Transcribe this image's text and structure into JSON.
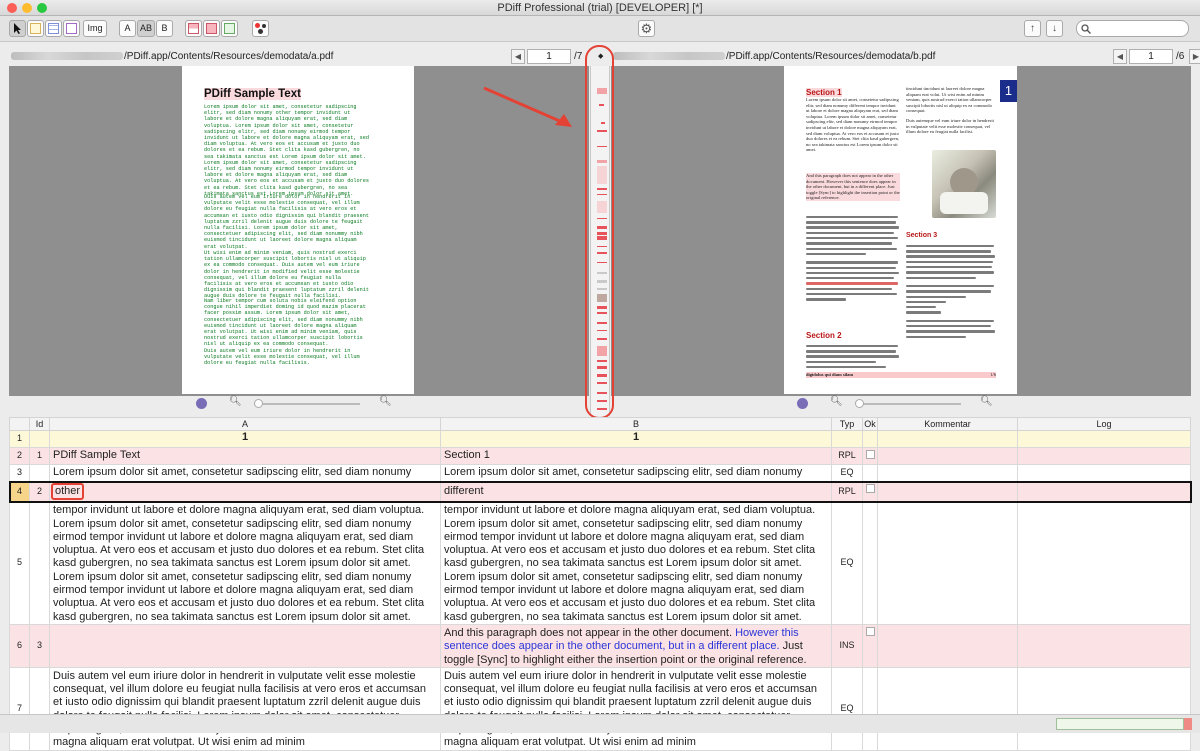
{
  "window": {
    "title": "PDiff Professional (trial) [DEVELOPER] [*]"
  },
  "toolbar": {
    "img_label": "Img",
    "a_label": "A",
    "ab_label": "AB",
    "b_label": "B"
  },
  "left": {
    "path": "/PDiff.app/Contents/Resources/demodata/a.pdf",
    "page": "1",
    "total": "/7"
  },
  "right": {
    "path": "/PDiff.app/Contents/Resources/demodata/b.pdf",
    "page": "1",
    "total": "/6"
  },
  "docA": {
    "title": "PDiff Sample Text",
    "p1": "Lorem ipsum dolor sit amet, consetetur sadipscing\nelitr, sed diam nonumy other tempor invidunt ut\nlabore et dolore magna aliquyam erat, sed diam\nvoluptua. Lorem ipsum dolor sit amet, consetetur\nsadipscing elitr, sed diam nonumy eirmod tempor\ninvidunt ut labore et dolore magna aliquyam erat, sed\ndiam voluptua. At vero eos et accusam et justo duo\ndolores et ea rebum. Stet clita kasd gubergren, no\nsea takimata sanctus est Lorem ipsum dolor sit amet.\nLorem ipsum dolor sit amet, consetetur sadipscing\nelitr, sed diam nonumy eirmod tempor invidunt ut\nlabore et dolore magna aliquyam erat, sed diam\nvoluptua. At vero eos et accusam et justo duo dolores\net ea rebum. Stet clita kasd gubergren, no sea\ntakimata sanctus est Lorem ipsum dolor sit amet.",
    "p2": "Duis autem vel eum iriure dolor in hendrerit in\nvulputate velit esse molestie consequat, vel illum\ndolore eu feugiat nulla facilisis at vero eros et\naccumsan et iusto odio dignissim qui blandit praesent\nluptatum zzril delenit augue duis dolore te feugait\nnulla facilisi. Lorem ipsum dolor sit amet,\nconsectetuer adipiscing elit, sed diam nonummy nibh\neuismod tincidunt ut laoreet dolore magna aliquam\nerat volutpat.",
    "p3": "Ut wisi enim ad minim veniam, quis nostrud exerci\ntation ullamcorper suscipit lobortis nisl ut aliquip\nex ea commodo consequat. Duis autem vel eum iriure\ndolor in hendrerit in modified velit esse molestie\nconsequat, vel illum dolore eu feugiat nulla\nfacilisis at vero eros et accumsan et iusto odio\ndignissim qui blandit praesent luptatum zzril delenit\naugue duis dolore te feugait nulla facilisi.",
    "p4": "Nam liber tempor cum soluta nobis eleifend option\ncongue nihil imperdiet doming id quod mazim placerat\nfacer possim assum. Lorem ipsum dolor sit amet,\nconsectetuer adipiscing elit, sed diam nonummy nibh\neuismod tincidunt ut laoreet dolore magna aliquam\nerat volutpat. Ut wisi enim ad minim veniam, quis\nnostrud exerci tation ullamcorper suscipit lobortis\nnisl ut aliquip ex ea commodo consequat.",
    "p5": "Duis autem vel eum iriure dolor in hendrerit in\nvulputate velit esse molestie consequat, vel illum\ndolore eu feugiat nulla facilisis."
  },
  "docB": {
    "section1": "Section 1",
    "section3": "Section 3",
    "section2": "Section 2",
    "badge": "1",
    "footer_left": "digidolus qui diam silam",
    "footer_right": "1/6",
    "intro": "Lorem ipsum dolor sit amet, consetetur sadipscing elitr, sed diam nonumy different tempor invidunt ut labore et dolore magna aliquyam erat, sed diam voluptua. Lorem ipsum dolor sit amet, consetetur sadipscing elitr, sed diam nonumy eirmod tempor invidunt ut labore et dolore magna aliquyam erat, sed diam voluptua. At vero eos et accusam et justo duo dolores et ea rebum. Stet clita kasd gubergren, no sea takimata sanctus est Lorem ipsum dolor sit amet.",
    "insert": "And this paragraph does not appear in the other document. However this sentence does appear in the other document, but in a different place. Just toggle [Sync] to highlight the insertion point or the original reference.",
    "col2": "tincidunt tincidunt ut laoreet dolore magna aliquam erat volut. Ut wisi enim ad minim veniam, quis nostrud exerci tation ullamcorper suscipit lobortis nisl ut aliquip ex ea commodo consequat.",
    "col2b": "Duis autemque vel eum iriure dolor in hendrerit in vulputate velit esse molestie consequat, vel illum dolore eu feugiat nulla facilisi."
  },
  "table": {
    "headers": {
      "id": "Id",
      "a": "A",
      "b": "B",
      "typ": "Typ",
      "ok": "Ok",
      "kommentar": "Kommentar",
      "log": "Log"
    },
    "rows": [
      {
        "n": "1",
        "id": "",
        "a": "1",
        "b": "1",
        "typ": ""
      },
      {
        "n": "2",
        "id": "1",
        "a": "PDiff Sample Text",
        "b": "Section 1",
        "typ": "RPL"
      },
      {
        "n": "3",
        "id": "",
        "a": "Lorem ipsum dolor sit amet, consetetur sadipscing elitr, sed diam nonumy",
        "b": "Lorem ipsum dolor sit amet, consetetur sadipscing elitr, sed diam nonumy",
        "typ": "EQ"
      },
      {
        "n": "4",
        "id": "2",
        "a": "other",
        "b": "different",
        "typ": "RPL"
      },
      {
        "n": "5",
        "id": "",
        "a": "tempor invidunt ut labore et dolore magna aliquyam erat, sed diam voluptua. Lorem ipsum dolor sit amet, consetetur sadipscing elitr, sed diam nonumy eirmod tempor invidunt ut labore et dolore magna aliquyam erat, sed diam voluptua. At vero eos et accusam et justo duo dolores et ea rebum. Stet clita kasd gubergren, no sea takimata sanctus est Lorem ipsum dolor sit amet. Lorem ipsum dolor sit amet, consetetur sadipscing elitr, sed diam nonumy eirmod tempor invidunt ut labore et dolore magna aliquyam erat, sed diam voluptua. At vero eos et accusam et justo duo dolores et ea rebum. Stet clita kasd gubergren, no sea takimata sanctus est Lorem ipsum dolor sit amet.",
        "b": "tempor invidunt ut labore et dolore magna aliquyam erat, sed diam voluptua. Lorem ipsum dolor sit amet, consetetur sadipscing elitr, sed diam nonumy eirmod tempor invidunt ut labore et dolore magna aliquyam erat, sed diam voluptua. At vero eos et accusam et justo duo dolores et ea rebum. Stet clita kasd gubergren, no sea takimata sanctus est Lorem ipsum dolor sit amet. Lorem ipsum dolor sit amet, consetetur sadipscing elitr, sed diam nonumy eirmod tempor invidunt ut labore et dolore magna aliquyam erat, sed diam voluptua. At vero eos et accusam et justo duo dolores et ea rebum. Stet clita kasd gubergren, no sea takimata sanctus est Lorem ipsum dolor sit amet.",
        "typ": "EQ"
      },
      {
        "n": "6",
        "id": "3",
        "a": "",
        "b_pre": "And this paragraph does not appear in the other document. ",
        "b_blue": "However this sentence does appear in the other document, but in a different place.",
        "b_post": " Just toggle [Sync] to highlight either the insertion point or the original reference.",
        "typ": "INS"
      },
      {
        "n": "7",
        "id": "",
        "a": "Duis autem vel eum iriure dolor in hendrerit in vulputate velit esse molestie consequat, vel illum dolore eu feugiat nulla facilisis at vero eros et accumsan et iusto odio dignissim qui blandit praesent luptatum zzril delenit augue duis dolore te feugait nulla facilisi. Lorem ipsum dolor sit amet, consectetuer adipiscing elit, sed diam nonummy nibh euismod tincidunt ut laoreet dolore magna aliquam erat volutpat. Ut wisi enim ad minim",
        "b": "Duis autem vel eum iriure dolor in hendrerit in vulputate velit esse molestie consequat, vel illum dolore eu feugiat nulla facilisis at vero eros et accumsan et iusto odio dignissim qui blandit praesent luptatum zzril delenit augue duis dolore te feugait nulla facilisi. Lorem ipsum dolor sit amet, consectetuer adipiscing elit, sed diam nonummy nibh euismod tincidunt ut laoreet dolore magna aliquam erat volutpat. Ut wisi enim ad minim",
        "typ": "EQ"
      }
    ]
  },
  "colors": {
    "accent_red": "#e34234",
    "diff_pink": "#fbe3e5",
    "header_yellow": "#fdf9d8",
    "link_blue": "#2a35d8"
  }
}
